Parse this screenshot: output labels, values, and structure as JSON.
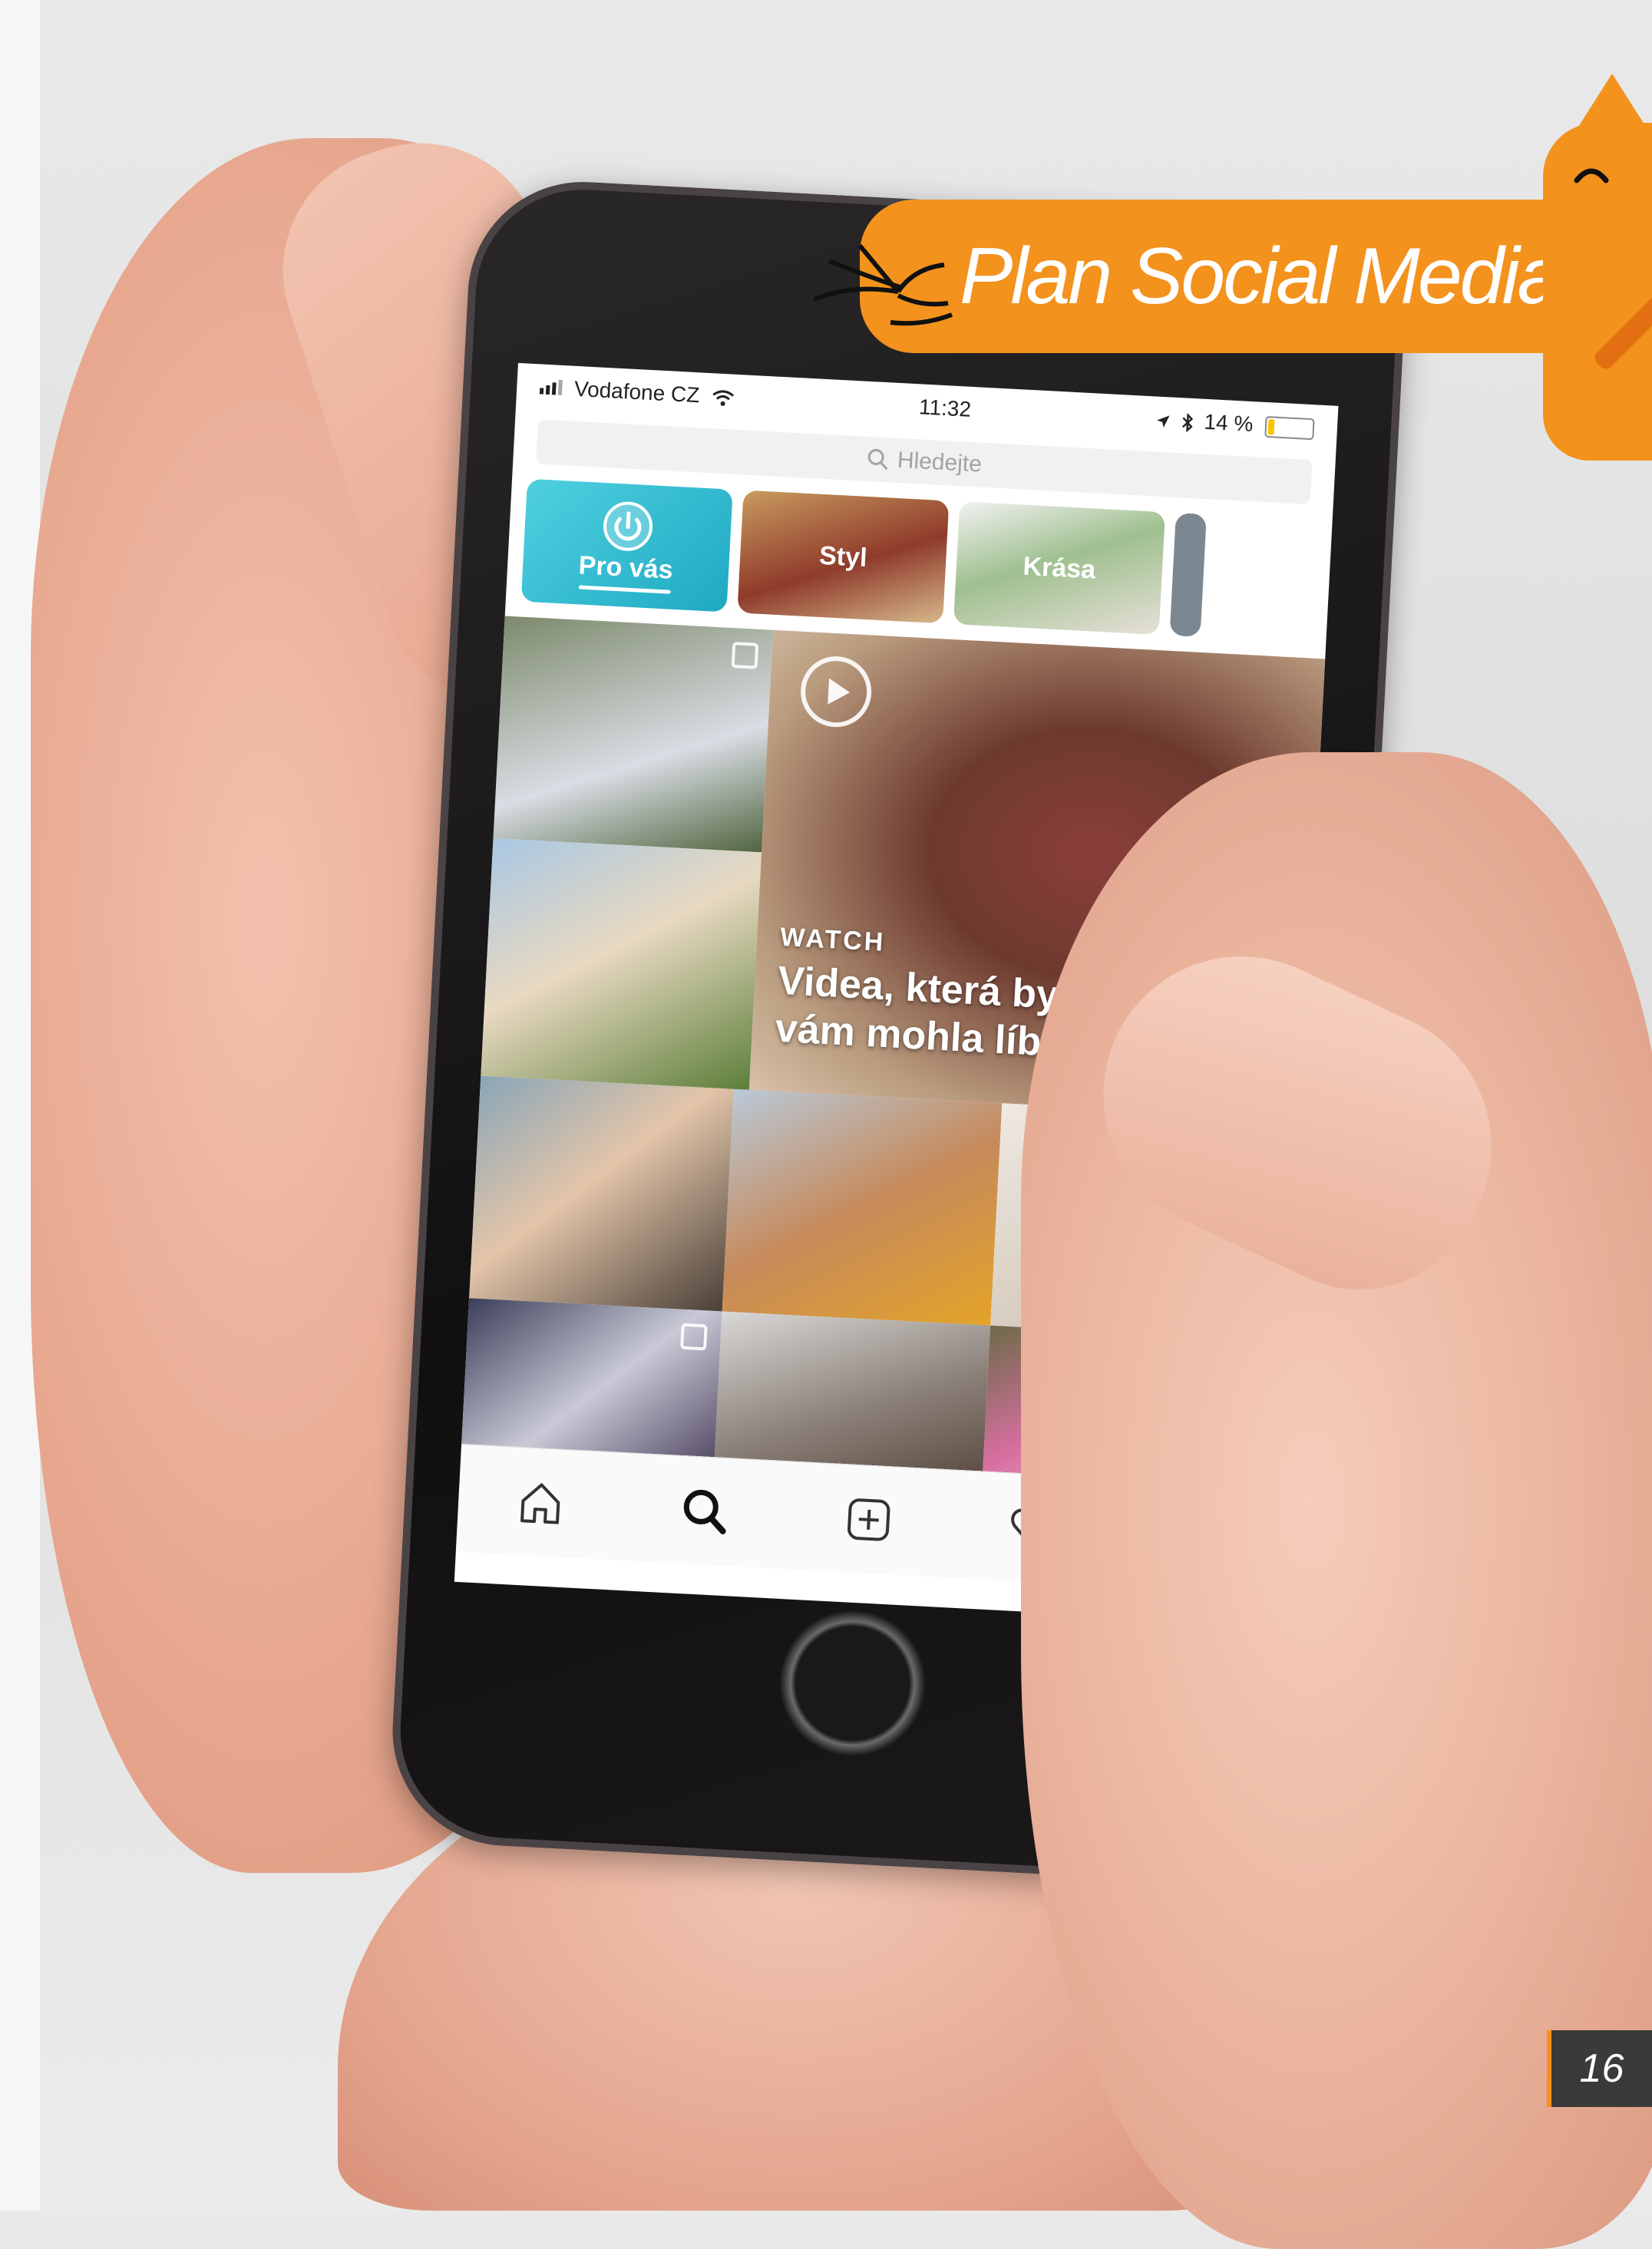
{
  "phone": {
    "status_bar": {
      "carrier": "Vodafone CZ",
      "time": "11:32",
      "battery_text": "14 %",
      "battery_level": 0.14
    },
    "search": {
      "placeholder": "Hledejte"
    },
    "topics": [
      {
        "label": "Pro vás"
      },
      {
        "label": "Styl"
      },
      {
        "label": "Krása"
      }
    ],
    "watch": {
      "label": "WATCH",
      "title": "Videa, která by\nvám mohla líbit"
    },
    "nav": {
      "home_icon": "home-icon",
      "search_icon": "search-icon",
      "add_icon": "add-post-icon",
      "activity_icon": "heart-icon",
      "profile_icon": "power-profile-icon"
    }
  },
  "banner": {
    "text": "Plan Social Media"
  },
  "page_number": "16",
  "colors": {
    "brand_orange": "#f3921d",
    "active_teal": "#1ea9c3",
    "page_box": "#3a3a3a"
  }
}
